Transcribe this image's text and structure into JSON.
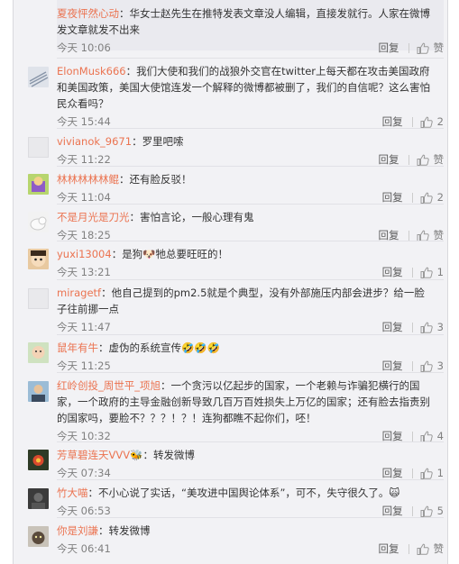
{
  "comments": [
    {
      "name": "夏夜怦然心动",
      "text": "华女士赵先生在推特发表文章没人编辑，直接发就行。人家在微博发文章就发不出来",
      "time": "今天 10:06",
      "reply": "回复",
      "likes": "赞",
      "avatar": "none"
    },
    {
      "name": "ElonMusk666",
      "text": "我们大使和我们的战狼外交官在twitter上每天都在攻击美国政府和美国政策，美国大使馆连发一个解释的微博都被删了，我们的自信呢？这么害怕民众看吗？",
      "time": "今天 15:44",
      "reply": "回复",
      "likes": "2",
      "avatar": "lines"
    },
    {
      "name": "vivianok_9671",
      "text": "罗里吧嗦",
      "time": "今天 11:22",
      "reply": "回复",
      "likes": "赞",
      "avatar": "blank"
    },
    {
      "name": "林林林林林鲲",
      "text": "还有脸反驳！",
      "time": "今天 11:04",
      "reply": "回复",
      "likes": "2",
      "avatar": "cartoon"
    },
    {
      "name": "不是月光是刀光",
      "text": "害怕言论，一般心理有鬼",
      "time": "今天 18:25",
      "reply": "回复",
      "likes": "赞",
      "avatar": "dog"
    },
    {
      "name": "yuxi13004",
      "text": "是狗🐶牠总要旺旺的！",
      "time": "今天 13:21",
      "reply": "回复",
      "likes": "1",
      "avatar": "face"
    },
    {
      "name": "miragetf",
      "text": "他自己提到的pm2.5就是个典型，没有外部施压内部会进步？给一脸子往前挪一点",
      "time": "今天 11:47",
      "reply": "回复",
      "likes": "3",
      "avatar": "blank"
    },
    {
      "name": "鼠年有牛",
      "text": "虚伪的系统宣传🤣🤣🤣",
      "time": "今天 11:25",
      "reply": "回复",
      "likes": "3",
      "avatar": "baby"
    },
    {
      "name": "红岭创投_周世平_项旭",
      "text": "一个贪污以亿起步的国家，一个老赖与诈骗犯横行的国家，一个政府的主导金融创新导致几百万百姓损失上万亿的国家；还有脸去指责别的国家吗，要脸不？？？！？！连狗都瞧不起你们，呸！",
      "time": "今天 10:32",
      "reply": "回复",
      "likes": "4",
      "avatar": "person"
    },
    {
      "name": "芳草碧连天VVV",
      "badge": "🐝",
      "text": "转发微博",
      "time": "今天 07:34",
      "reply": "回复",
      "likes": "1",
      "avatar": "flower"
    },
    {
      "name": "竹大喵",
      "text": "不小心说了实话，“美攻进中国舆论体系”，可不，失守很久了。🙀",
      "time": "今天 06:53",
      "reply": "回复",
      "likes": "5",
      "avatar": "dark"
    },
    {
      "name": "你是刘謙",
      "text": "转发微博",
      "time": "今天 06:41",
      "reply": "回复",
      "likes": "赞",
      "avatar": "cat"
    }
  ],
  "colors": {
    "name": "#eb7350",
    "text": "#333333",
    "meta": "#808080",
    "bg": "#f2f2f5"
  }
}
